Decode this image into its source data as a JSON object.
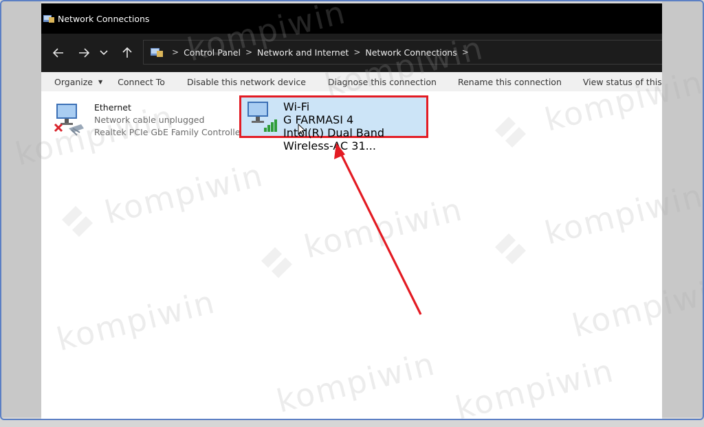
{
  "window": {
    "title": "Network Connections"
  },
  "nav": {
    "back_icon": "arrow-left-icon",
    "forward_icon": "arrow-right-icon",
    "recent_icon": "chevron-down-icon",
    "up_icon": "arrow-up-icon"
  },
  "breadcrumb": [
    "Control Panel",
    "Network and Internet",
    "Network Connections"
  ],
  "commands": [
    {
      "label": "Organize",
      "has_dropdown": true
    },
    {
      "label": "Connect To"
    },
    {
      "label": "Disable this network device"
    },
    {
      "label": "Diagnose this connection"
    },
    {
      "label": "Rename this connection"
    },
    {
      "label": "View status of this connection"
    }
  ],
  "connections": [
    {
      "name": "Ethernet",
      "status": "Network cable unplugged",
      "device": "Realtek PCIe GbE Family Controller",
      "icon": "network-disconnected-icon",
      "selected": false
    },
    {
      "name": "Wi-Fi",
      "status": "G FARMASI 4",
      "device": "Intel(R) Dual Band Wireless-AC 31...",
      "icon": "wifi-signal-icon",
      "selected": true
    }
  ],
  "watermark": {
    "text": "kompiwin"
  },
  "colors": {
    "highlight_border": "#e31b23",
    "arrow": "#e31b23",
    "selection": "#cce4f7",
    "frame": "#5b7fc4"
  }
}
